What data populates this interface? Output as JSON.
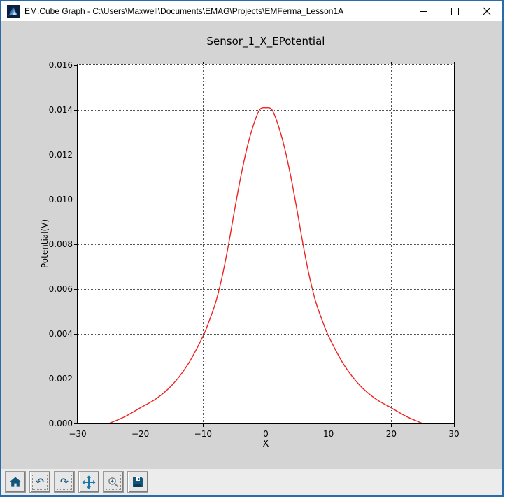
{
  "window": {
    "title": "EM.Cube Graph - C:\\Users\\Maxwell\\Documents\\EMAG\\Projects\\EMFerma_Lesson1A",
    "controls": [
      "minimize",
      "maximize",
      "close"
    ]
  },
  "colors": {
    "accent_border": "#2a6da6",
    "titlebar_bg": "#ffffff",
    "figure_bg": "#d4d4d4",
    "plot_bg": "#ffffff",
    "grid": "#555555",
    "axis": "#000000",
    "curve": "#ee2222",
    "toolbar_bg": "#ececec",
    "icon_blue": "#11557c",
    "pan_blue": "#1b75a8",
    "zoom_gray": "#7a7a7a"
  },
  "chart_data": {
    "type": "line",
    "title": "Sensor_1_X_EPotential",
    "xlabel": "X",
    "ylabel": "Potential(V)",
    "xlim": [
      -30,
      30
    ],
    "ylim": [
      0,
      0.016
    ],
    "grid": true,
    "grid_style": "dotted",
    "legend": "none",
    "line_color": "#ee2222",
    "x_ticks": [
      {
        "v": -30,
        "label": "−30"
      },
      {
        "v": -20,
        "label": "−20"
      },
      {
        "v": -10,
        "label": "−10"
      },
      {
        "v": 0,
        "label": "0"
      },
      {
        "v": 10,
        "label": "10"
      },
      {
        "v": 20,
        "label": "20"
      },
      {
        "v": 30,
        "label": "30"
      }
    ],
    "y_ticks": [
      {
        "v": 0.0,
        "label": "0.000"
      },
      {
        "v": 0.002,
        "label": "0.002"
      },
      {
        "v": 0.004,
        "label": "0.004"
      },
      {
        "v": 0.006,
        "label": "0.006"
      },
      {
        "v": 0.008,
        "label": "0.008"
      },
      {
        "v": 0.01,
        "label": "0.010"
      },
      {
        "v": 0.012,
        "label": "0.012"
      },
      {
        "v": 0.014,
        "label": "0.014"
      },
      {
        "v": 0.016,
        "label": "0.016"
      }
    ],
    "series": [
      {
        "name": "Sensor_1_X_EPotential",
        "x": [
          -25,
          -22.5,
          -20,
          -17.5,
          -15,
          -12.5,
          -10,
          -9,
          -8,
          -7,
          -6,
          -5,
          -4,
          -3,
          -2,
          -1,
          0,
          1,
          2,
          3,
          4,
          5,
          6,
          7,
          8,
          9,
          10,
          12.5,
          15,
          17.5,
          20,
          22.5,
          25
        ],
        "y": [
          0.0,
          0.0003,
          0.0007,
          0.0011,
          0.0017,
          0.0026,
          0.0039,
          0.0046,
          0.0054,
          0.0065,
          0.0079,
          0.0095,
          0.011,
          0.0123,
          0.0133,
          0.014,
          0.0141,
          0.014,
          0.0133,
          0.0123,
          0.011,
          0.0095,
          0.0079,
          0.0065,
          0.0054,
          0.0046,
          0.0039,
          0.0026,
          0.0017,
          0.0011,
          0.0007,
          0.0003,
          0.0
        ]
      }
    ]
  },
  "toolbar": {
    "buttons": [
      "home",
      "back",
      "forward",
      "pan",
      "zoom-to-rect",
      "save"
    ]
  }
}
